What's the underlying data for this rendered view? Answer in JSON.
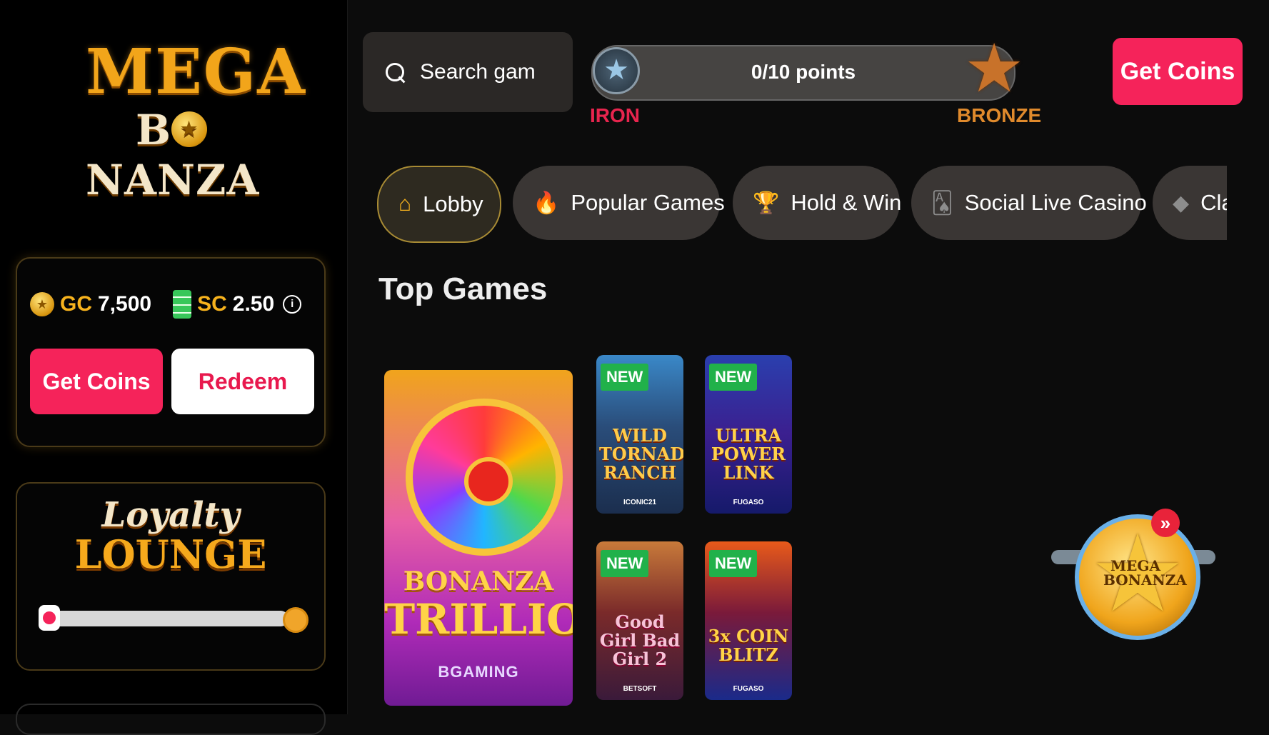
{
  "sidebar": {
    "logo": {
      "line1": "MEGA",
      "line2_a": "B",
      "line2_b": "NANZA",
      "coin_glyph": "★"
    },
    "wallet": {
      "gc_label": "GC",
      "gc_value": "7,500",
      "sc_label": "SC",
      "sc_value": "2.50",
      "info_glyph": "i",
      "get_coins_label": "Get Coins",
      "redeem_label": "Redeem"
    },
    "loyalty": {
      "title_line1": "Loyalty",
      "title_line2": "LOUNGE",
      "progress": 0
    }
  },
  "header": {
    "search_placeholder": "Search gam",
    "progress_text": "0/10 points",
    "progress": 0,
    "current_tier": "IRON",
    "next_tier": "BRONZE",
    "get_coins_label": "Get Coins"
  },
  "categories": [
    {
      "label": "Lobby",
      "icon": "home-icon",
      "glyph": "⌂",
      "active": true
    },
    {
      "label": "Popular Games",
      "icon": "flame-icon",
      "glyph": "🔥",
      "active": false
    },
    {
      "label": "Hold & Win",
      "icon": "trophy-icon",
      "glyph": "🏆",
      "active": false
    },
    {
      "label": "Social Live Casino",
      "icon": "card-icon",
      "glyph": "🂡",
      "active": false
    },
    {
      "label": "Cla",
      "icon": "diamond-icon",
      "glyph": "◆",
      "active": false
    }
  ],
  "section_title": "Top Games",
  "games": {
    "featured": {
      "title_line1": "BONANZA",
      "title_line2": "TRILLION",
      "provider": "BGAMING"
    },
    "items": [
      {
        "badge": "NEW",
        "title": "WILD TORNADO RANCH",
        "provider": "ICONIC21"
      },
      {
        "badge": "NEW",
        "title": "ULTRA POWER LINK",
        "provider": "FUGASO"
      },
      {
        "badge": "NEW",
        "title": "Good Girl Bad Girl 2",
        "provider": "BETSOFT"
      },
      {
        "badge": "NEW",
        "title": "3x COIN BLITZ",
        "provider": "FUGASO"
      }
    ]
  },
  "floating_badge": {
    "label_line1": "MEGA",
    "label_line2": "BONANZA",
    "arrow_glyph": "»"
  },
  "colors": {
    "accent_pink": "#f5235a",
    "gold": "#f6b21d",
    "iron_red": "#e8254e",
    "bronze": "#e08a2c",
    "new_green": "#21b14a"
  }
}
